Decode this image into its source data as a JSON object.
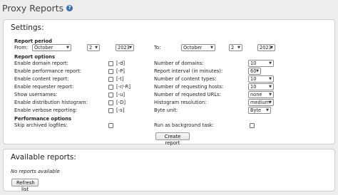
{
  "header": {
    "title": "Proxy Reports",
    "help_icon": "?"
  },
  "settings": {
    "heading": "Settings:",
    "report_period": {
      "heading": "Report period",
      "from_label": "From:",
      "from_month": "October",
      "from_day": "2",
      "from_year": "2023",
      "to_label": "To:",
      "to_month": "October",
      "to_day": "2",
      "to_year": "2023"
    },
    "report_options": {
      "heading": "Report options",
      "checkboxes": [
        {
          "label": "Enable domain report:",
          "flag": "[-d]"
        },
        {
          "label": "Enable performance report:",
          "flag": "[-P]"
        },
        {
          "label": "Enable content report:",
          "flag": "[-t]"
        },
        {
          "label": "Enable requester report:",
          "flag": "[-r/-R]"
        },
        {
          "label": "Show usernames:",
          "flag": "[-u]"
        },
        {
          "label": "Enable distribution histogram:",
          "flag": "[-D]"
        },
        {
          "label": "Enable verbose reporting:",
          "flag": "[-s]"
        }
      ],
      "selects": [
        {
          "label": "Number of domains:",
          "value": "10"
        },
        {
          "label": "Report interval (in minutes):",
          "value": "60"
        },
        {
          "label": "Number of content types:",
          "value": "10"
        },
        {
          "label": "Number of requesting hosts:",
          "value": "10"
        },
        {
          "label": "Number of requested URLs:",
          "value": "none"
        },
        {
          "label": "Histogram resolution:",
          "value": "medium"
        },
        {
          "label": "Byte unit:",
          "value": "Byte"
        }
      ]
    },
    "performance_options": {
      "heading": "Performance options",
      "skip_label": "Skip archived logfiles:",
      "background_label": "Run as background task:"
    },
    "create_button": "Create report"
  },
  "reports": {
    "heading": "Available reports:",
    "empty_text": "No reports available",
    "refresh_button": "Refresh list"
  },
  "colors": {
    "background": "#ededed",
    "panel": "#ffffff",
    "help_icon": "#3a6fb7"
  }
}
